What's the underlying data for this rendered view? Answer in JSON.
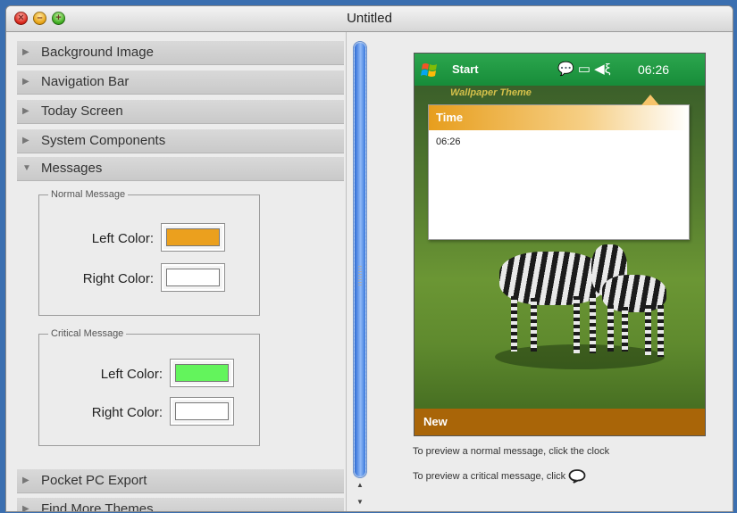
{
  "window": {
    "title": "Untitled",
    "controls": {
      "close": "×",
      "minimize": "–",
      "zoom": "+"
    }
  },
  "sidebar": {
    "sections_top": [
      {
        "label": "Background Image",
        "expanded": false
      },
      {
        "label": "Navigation Bar",
        "expanded": false
      },
      {
        "label": "Today Screen",
        "expanded": false
      },
      {
        "label": "System Components",
        "expanded": false
      },
      {
        "label": "Messages",
        "expanded": true
      }
    ],
    "sections_bottom": [
      {
        "label": "Pocket PC Export",
        "expanded": false
      },
      {
        "label": "Find More Themes",
        "expanded": false
      }
    ],
    "expand_arrow": "▶",
    "collapse_arrow": "▼"
  },
  "messages": {
    "normal": {
      "legend": "Normal Message",
      "left_label": "Left Color:",
      "right_label": "Right Color:",
      "left_color": "#eba01e",
      "right_color": "#ffffff"
    },
    "critical": {
      "legend": "Critical Message",
      "left_label": "Left Color:",
      "right_label": "Right Color:",
      "left_color": "#63f45c",
      "right_color": "#ffffff"
    }
  },
  "preview": {
    "start_label": "Start",
    "tray_icons": "💬 ▭ ◀ξ",
    "clock": "06:26",
    "wallpaper_text": "Wallpaper Theme",
    "bubble_title": "Time",
    "bubble_text": "06:26",
    "menu_left": "New",
    "hint_normal": "To preview a normal message, click the clock",
    "hint_critical": "To preview a critical message, click"
  },
  "colors": {
    "taskbar": "#1f9a42",
    "menubar": "#a96508",
    "bubble_accent": "#e79e1d"
  },
  "icons": {
    "start": "windows-flag-icon",
    "notification": "speech-bubble-icon",
    "battery": "battery-icon",
    "volume": "speaker-icon"
  }
}
